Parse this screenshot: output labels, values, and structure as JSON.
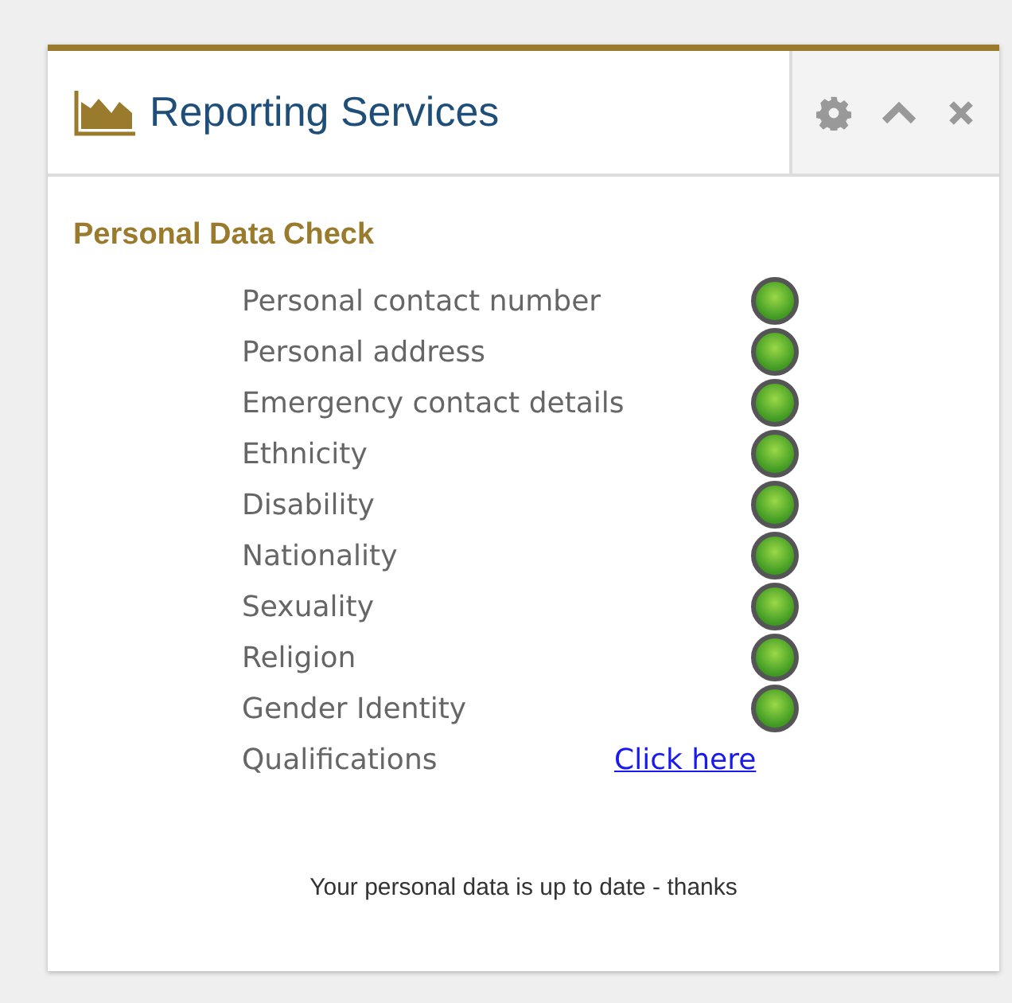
{
  "panel": {
    "title": "Reporting Services"
  },
  "section": {
    "title": "Personal Data Check"
  },
  "items": [
    {
      "label": "Personal contact number",
      "kind": "indicator",
      "lit": true
    },
    {
      "label": "Personal address",
      "kind": "indicator",
      "lit": true
    },
    {
      "label": "Emergency contact details",
      "kind": "indicator",
      "lit": true
    },
    {
      "label": "Ethnicity",
      "kind": "indicator",
      "lit": true
    },
    {
      "label": "Disability",
      "kind": "indicator",
      "lit": true
    },
    {
      "label": "Nationality",
      "kind": "indicator",
      "lit": true
    },
    {
      "label": "Sexuality",
      "kind": "indicator",
      "lit": true
    },
    {
      "label": "Religion",
      "kind": "indicator",
      "lit": true
    },
    {
      "label": "Gender Identity",
      "kind": "indicator",
      "lit": true
    },
    {
      "label": "Qualifications",
      "kind": "link",
      "link": "Click here"
    }
  ],
  "message": "Your personal data is up to date - thanks"
}
